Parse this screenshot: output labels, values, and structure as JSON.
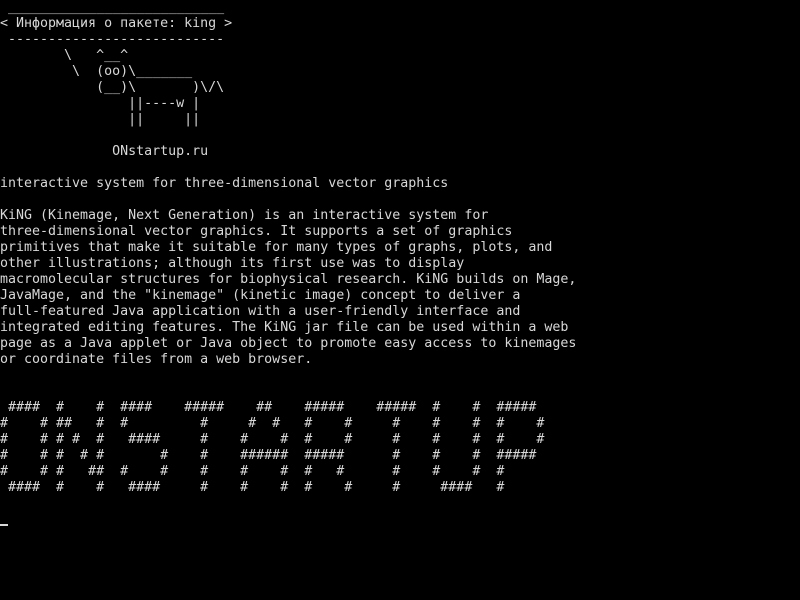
{
  "terminal": {
    "cowsay_lines": [
      " ___________________________",
      "< Информация о пакете: king >",
      " ---------------------------",
      "        \\   ^__^",
      "         \\  (oo)\\_______",
      "            (__)\\       )\\/\\",
      "                ||----w |",
      "                ||     ||",
      "",
      "              ONstartup.ru"
    ],
    "summary": "interactive system for three-dimensional vector graphics",
    "description_lines": [
      "KiNG (Kinemage, Next Generation) is an interactive system for",
      "three-dimensional vector graphics. It supports a set of graphics",
      "primitives that make it suitable for many types of graphs, plots, and",
      "other illustrations; although its first use was to display",
      "macromolecular structures for biophysical research. KiNG builds on Mage,",
      "JavaMage, and the \"kinemage\" (kinetic image) concept to deliver a",
      "full-featured Java application with a user-friendly interface and",
      "integrated editing features. The KiNG jar file can be used within a web",
      "page as a Java applet or Java object to promote easy access to kinemages",
      "or coordinate files from a web browser."
    ],
    "banner_lines": [
      " ####  #    #  ####    #####    ##    #####    #####  #    #  #####",
      "#    # ##   #  #         #     #  #   #    #     #    #    #  #    #",
      "#    # # #  #   ####     #    #    #  #    #     #    #    #  #    #",
      "#    # #  # #       #    #    ######  #####      #    #    #  #####",
      "#    # #   ##  #    #    #    #    #  #   #      #    #    #  #",
      " ####  #    #   ####     #    #    #  #    #     #     ####   #"
    ],
    "cursor": "_"
  }
}
